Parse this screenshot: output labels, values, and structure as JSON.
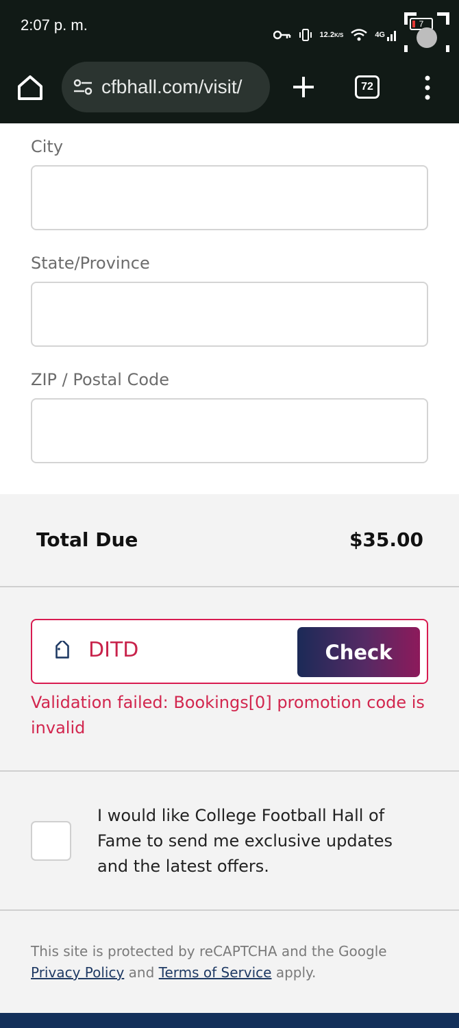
{
  "status_bar": {
    "time": "2:07 p. m.",
    "net_speed_value": "12.2",
    "net_speed_unit": "K/S",
    "network": "4G",
    "battery_level": "7"
  },
  "browser": {
    "url": "cfbhall.com/visit/",
    "tab_count": "72"
  },
  "form": {
    "city_label": "City",
    "city_value": "",
    "state_label": "State/Province",
    "state_value": "",
    "zip_label": "ZIP / Postal Code",
    "zip_value": ""
  },
  "total": {
    "label": "Total Due",
    "amount": "$35.00"
  },
  "promo": {
    "code_value": "DITD",
    "check_label": "Check",
    "error_message": "Validation failed: Bookings[0] promotion code is invalid",
    "border_color": "#d81b50",
    "error_color": "#d2264e"
  },
  "optin": {
    "checked": false,
    "text": "I would like College Football Hall of Fame to send me exclusive updates and the latest offers."
  },
  "recaptcha": {
    "prefix": "This site is protected by reCAPTCHA and the Google",
    "privacy_link": "Privacy Policy",
    "conjunction": "and",
    "terms_link": "Terms of Service",
    "suffix": "apply."
  }
}
